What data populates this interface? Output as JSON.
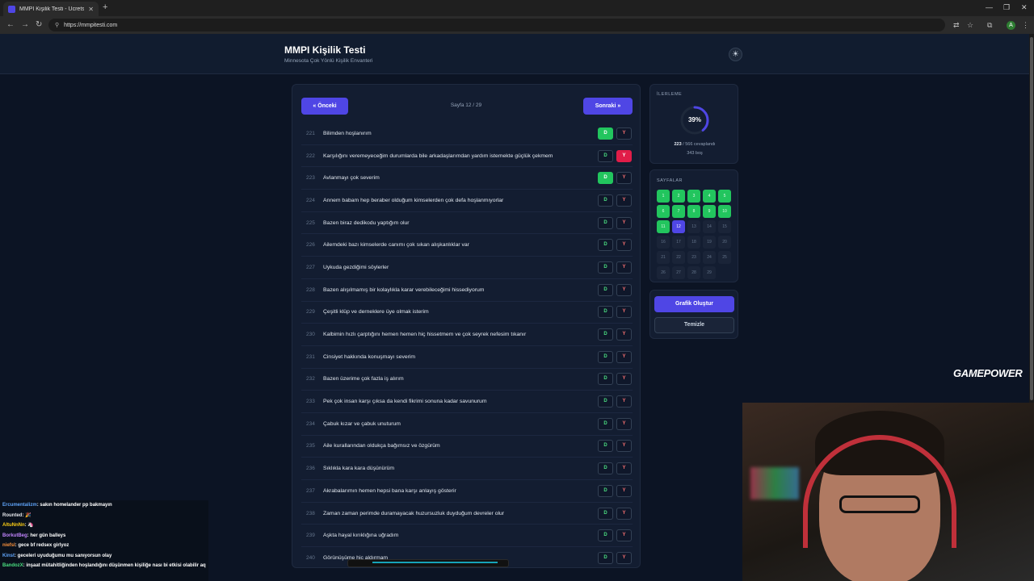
{
  "browser": {
    "tab_title": "MMPI Kişilik Testi - Ücretsiz Onl...",
    "url": "https://mmpitesti.com"
  },
  "app": {
    "title": "MMPI Kişilik Testi",
    "subtitle": "Minnesota Çok Yönlü Kişilik Envanteri",
    "theme_icon": "sun-icon"
  },
  "nav": {
    "prev_label": "« Önceki",
    "next_label": "Sonraki »",
    "page_indicator": "Sayfa 12 / 29"
  },
  "answer_labels": {
    "yes": "D",
    "no": "Y"
  },
  "questions": [
    {
      "num": "221",
      "text": "Bilimden hoşlanırım",
      "answer": "D"
    },
    {
      "num": "222",
      "text": "Karşılığını veremeyeceğim durumlarda bile arkadaşlarımdan yardım istemekte güçlük çekmem",
      "answer": "Y"
    },
    {
      "num": "223",
      "text": "Avlanmayı çok severim",
      "answer": "D"
    },
    {
      "num": "224",
      "text": "Annem babam hep beraber olduğum kimselerden çok defa hoşlanmıyorlar",
      "answer": ""
    },
    {
      "num": "225",
      "text": "Bazen biraz dedikodu yaptığım olur",
      "answer": ""
    },
    {
      "num": "226",
      "text": "Ailemdeki bazı kimselerde canımı çok sıkan alışkanlıklar var",
      "answer": ""
    },
    {
      "num": "227",
      "text": "Uykuda gezdiğimi söylerler",
      "answer": ""
    },
    {
      "num": "228",
      "text": "Bazen alışılmamış bir kolaylıkla karar verebileceğimi hissediyorum",
      "answer": ""
    },
    {
      "num": "229",
      "text": "Çeşitli klüp ve derneklere üye olmak isterim",
      "answer": ""
    },
    {
      "num": "230",
      "text": "Kalbimin hızlı çarptığını hemen hemen hiç hissetmem ve çok seyrek nefesim tıkanır",
      "answer": ""
    },
    {
      "num": "231",
      "text": "Cinsiyet hakkında konuşmayı severim",
      "answer": ""
    },
    {
      "num": "232",
      "text": "Bazen üzerime çok fazla iş alırım",
      "answer": ""
    },
    {
      "num": "233",
      "text": "Pek çok insan karşı çıksa da kendi fikrimi sonuna kadar savunurum",
      "answer": ""
    },
    {
      "num": "234",
      "text": "Çabuk kızar ve çabuk unuturum",
      "answer": ""
    },
    {
      "num": "235",
      "text": "Aile kurallarından oldukça bağımsız ve özgürüm",
      "answer": ""
    },
    {
      "num": "236",
      "text": "Sıklıkla kara kara düşünürüm",
      "answer": ""
    },
    {
      "num": "237",
      "text": "Akrabalarımın hemen hepsi bana karşı anlayış gösterir",
      "answer": ""
    },
    {
      "num": "238",
      "text": "Zaman zaman perimde duramayacak huzursuzluk duyduğum devreler olur",
      "answer": ""
    },
    {
      "num": "239",
      "text": "Aşkta hayal kırıklığına uğradım",
      "answer": ""
    },
    {
      "num": "240",
      "text": "Görünüşüme hiç aldırmam",
      "answer": ""
    }
  ],
  "progress": {
    "label": "İLERLEME",
    "percent_text": "39%",
    "fraction": 0.39,
    "answered": "223",
    "answered_suffix": "/ 566 cevaplandı",
    "empty_text": "343 boş",
    "ring_color": "#4f46e5"
  },
  "pages": {
    "label": "SAYFALAR",
    "items": [
      {
        "n": "1",
        "state": "done"
      },
      {
        "n": "2",
        "state": "done"
      },
      {
        "n": "3",
        "state": "done"
      },
      {
        "n": "4",
        "state": "done"
      },
      {
        "n": "5",
        "state": "done"
      },
      {
        "n": "6",
        "state": "done"
      },
      {
        "n": "7",
        "state": "done"
      },
      {
        "n": "8",
        "state": "done"
      },
      {
        "n": "9",
        "state": "done"
      },
      {
        "n": "10",
        "state": "done"
      },
      {
        "n": "11",
        "state": "done"
      },
      {
        "n": "12",
        "state": "current"
      },
      {
        "n": "13",
        "state": "todo"
      },
      {
        "n": "14",
        "state": "todo"
      },
      {
        "n": "15",
        "state": "todo"
      },
      {
        "n": "16",
        "state": "todo"
      },
      {
        "n": "17",
        "state": "todo"
      },
      {
        "n": "18",
        "state": "todo"
      },
      {
        "n": "19",
        "state": "todo"
      },
      {
        "n": "20",
        "state": "todo"
      },
      {
        "n": "21",
        "state": "todo"
      },
      {
        "n": "22",
        "state": "todo"
      },
      {
        "n": "23",
        "state": "todo"
      },
      {
        "n": "24",
        "state": "todo"
      },
      {
        "n": "25",
        "state": "todo"
      },
      {
        "n": "26",
        "state": "todo"
      },
      {
        "n": "27",
        "state": "todo"
      },
      {
        "n": "28",
        "state": "todo"
      },
      {
        "n": "29",
        "state": "todo"
      }
    ]
  },
  "actions": {
    "chart_label": "Grafik Oluştur",
    "clear_label": "Temizle"
  },
  "overlay": {
    "brand": "GAMEPOWER",
    "chat": [
      {
        "user": "Ercumentalizm",
        "color": "#60a5fa",
        "msg": ": sakın homelander pp bakmayın"
      },
      {
        "user": "Rounted",
        "color": "#e5e7eb",
        "msg": ": 🎉"
      },
      {
        "user": "AltuNnNn",
        "color": "#facc15",
        "msg": ": 🦄"
      },
      {
        "user": "BorkutBeg",
        "color": "#c084fc",
        "msg": ": her gün balleys"
      },
      {
        "user": "niefsl",
        "color": "#fb923c",
        "msg": ": gece bf redsex girlyoz"
      },
      {
        "user": "Kinst",
        "color": "#60a5fa",
        "msg": ": geceleri uyuduğumu mu sanıyorsun olay"
      },
      {
        "user": "BandozX",
        "color": "#4ade80",
        "msg": ": inşaat mütahitliğinden hoşlandığını düşünmen kişiliğe nası bi etkisi olabilir aq"
      }
    ]
  }
}
